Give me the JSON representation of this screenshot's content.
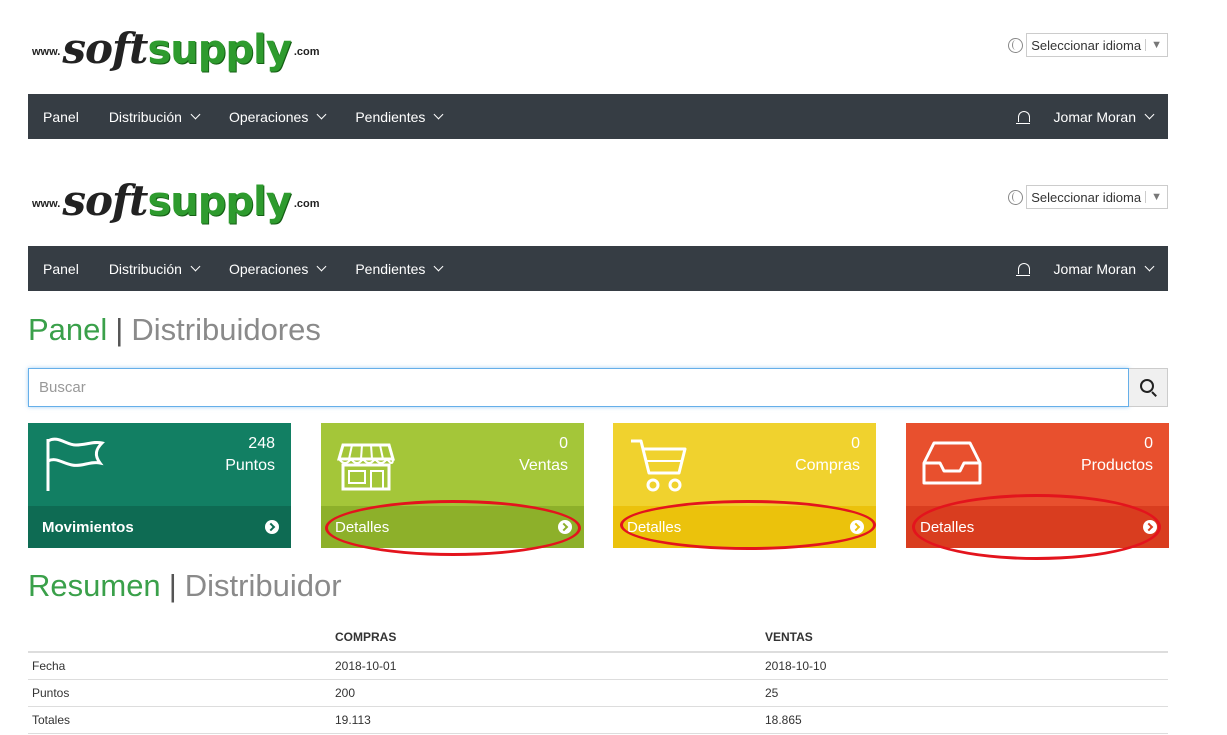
{
  "logo": {
    "www": "www.",
    "soft": "soft",
    "supply": "supply",
    "com": ".com"
  },
  "language": {
    "label": "Seleccionar idioma",
    "arrow": "▼"
  },
  "nav": {
    "items": [
      "Panel",
      "Distribución",
      "Operaciones",
      "Pendientes"
    ],
    "user": "Jomar Moran"
  },
  "heading": {
    "primary": "Panel",
    "secondary": "Distribuidores"
  },
  "search": {
    "placeholder": "Buscar"
  },
  "cards": [
    {
      "value": "248",
      "label": "Puntos",
      "footer": "Movimientos",
      "icon": "flag-icon",
      "color": "#127f63"
    },
    {
      "value": "0",
      "label": "Ventas",
      "footer": "Detalles",
      "icon": "store-icon",
      "color": "#a4c639"
    },
    {
      "value": "0",
      "label": "Compras",
      "footer": "Detalles",
      "icon": "cart-icon",
      "color": "#f0d22e"
    },
    {
      "value": "0",
      "label": "Productos",
      "footer": "Detalles",
      "icon": "inbox-icon",
      "color": "#e8502e"
    }
  ],
  "summary_heading": {
    "primary": "Resumen",
    "secondary": "Distribuidor"
  },
  "table": {
    "headers": [
      "",
      "COMPRAS",
      "VENTAS"
    ],
    "rows": [
      [
        "Fecha",
        "2018-10-01",
        "2018-10-10"
      ],
      [
        "Puntos",
        "200",
        "25"
      ],
      [
        "Totales",
        "19.113",
        "18.865"
      ]
    ]
  }
}
